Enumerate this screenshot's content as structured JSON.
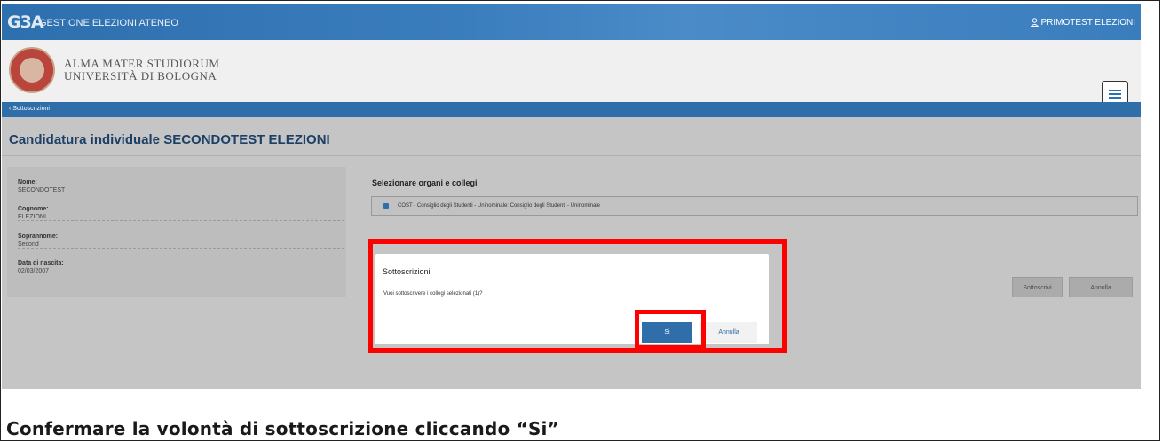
{
  "topbar": {
    "logo": "G3A",
    "app_title": "GESTIONE ELEZIONI ATENEO",
    "user": "PRIMOTEST ELEZIONI"
  },
  "header": {
    "university_line1": "ALMA MATER STUDIORUM",
    "university_line2": "UNIVERSITÀ DI BOLOGNA",
    "menu_icon": "hamburger-icon"
  },
  "breadcrumb": {
    "back_label": "Sottoscrizioni"
  },
  "page": {
    "title": "Candidatura individuale SECONDOTEST ELEZIONI"
  },
  "candidate": {
    "fields": [
      {
        "label": "Nome:",
        "value": "SECONDOTEST"
      },
      {
        "label": "Cognome:",
        "value": "ELEZIONI"
      },
      {
        "label": "Soprannome:",
        "value": "Second"
      },
      {
        "label": "Data di nascita:",
        "value": "02/03/2007"
      }
    ]
  },
  "organs": {
    "title": "Selezionare organi e collegi",
    "items": [
      {
        "label": "COST - Consiglio degli Studenti - Uninominale: Consiglio degli Studenti - Uninominale",
        "checked": true
      }
    ]
  },
  "actions": {
    "subscribe_label": "Sottoscrivi",
    "cancel_label": "Annulla"
  },
  "dialog": {
    "title": "Sottoscrizioni",
    "message": "Vuoi sottoscrivere i collegi selezionati (1)?",
    "confirm_label": "Si",
    "cancel_label": "Annulla"
  },
  "caption": "Confermare la volontà di sottoscrizione cliccando “Si”",
  "colors": {
    "primary": "#2f6ea8",
    "highlight": "#ff0000",
    "title_text": "#1c3f66"
  }
}
